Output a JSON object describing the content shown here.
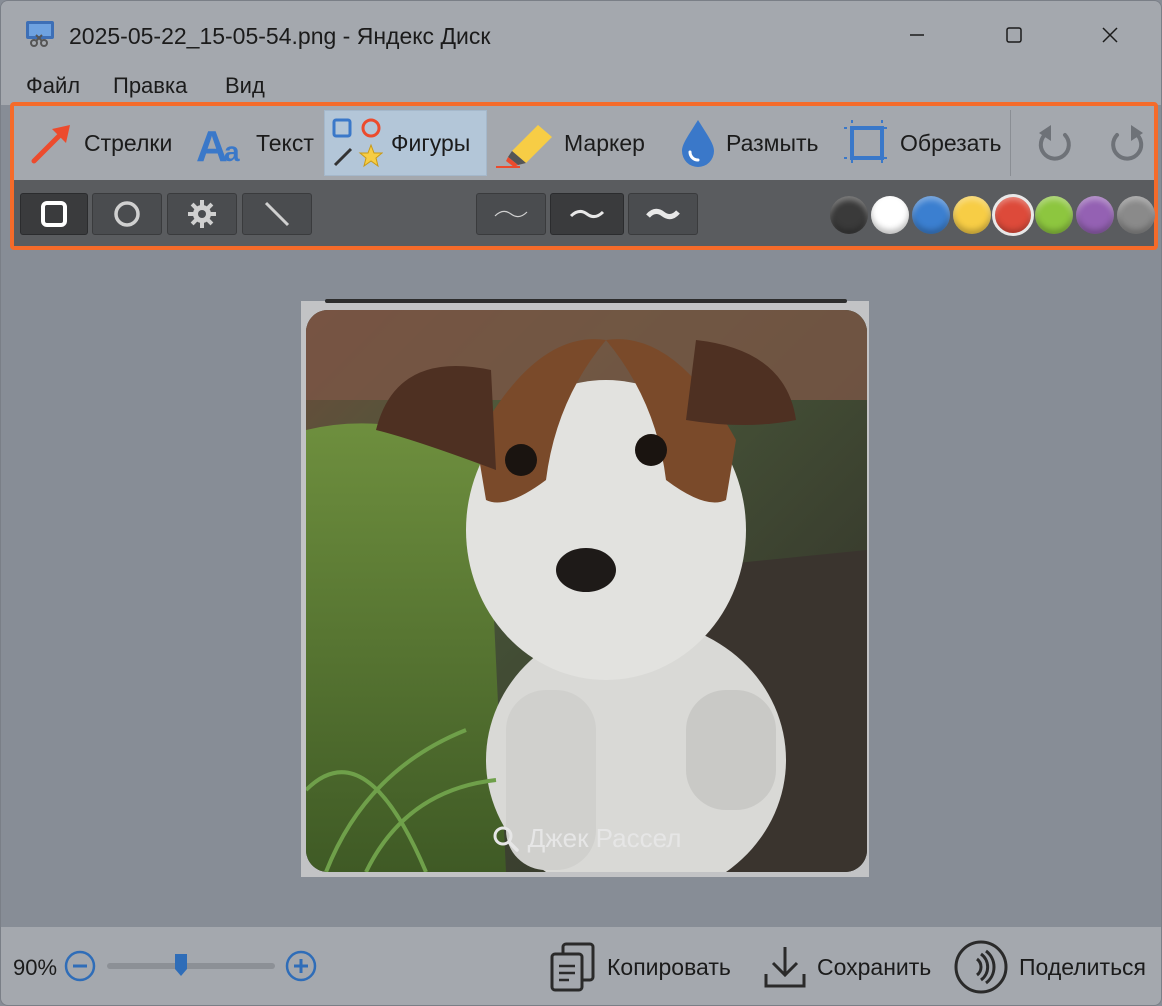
{
  "window": {
    "title": "2025-05-22_15-05-54.png - Яндекс Диск"
  },
  "menu": {
    "items": [
      "Файл",
      "Правка",
      "Вид"
    ]
  },
  "toolbar": {
    "tools": [
      {
        "label": "Стрелки",
        "icon": "arrow-icon",
        "active": false
      },
      {
        "label": "Текст",
        "icon": "text-icon",
        "active": false
      },
      {
        "label": "Фигуры",
        "icon": "shapes-icon",
        "active": true
      },
      {
        "label": "Маркер",
        "icon": "marker-icon",
        "active": false
      },
      {
        "label": "Размыть",
        "icon": "blur-drop-icon",
        "active": false
      },
      {
        "label": "Обрезать",
        "icon": "crop-icon",
        "active": false
      }
    ],
    "undo_icon": "undo-icon",
    "redo_icon": "redo-icon"
  },
  "shape_options": {
    "shapes": [
      "rectangle",
      "ellipse",
      "gear",
      "line"
    ],
    "selected_shape": "rectangle",
    "thickness": [
      "thin",
      "medium",
      "thick"
    ],
    "selected_thickness": "medium",
    "colors": [
      "#3a3a3a",
      "#ffffff",
      "#3b7fd0",
      "#f7cd45",
      "#dd4a3a",
      "#8dc63f",
      "#9461b3",
      "#8a8a8a"
    ],
    "selected_color": "#dd4a3a"
  },
  "image": {
    "caption": "Джек Рассел"
  },
  "bottom": {
    "zoom": "90%",
    "zoom_level": 0.45,
    "copy_label": "Копировать",
    "save_label": "Сохранить",
    "share_label": "Поделиться"
  },
  "colors": {
    "accent_frame": "#f56b2a",
    "active_tool": "#b3c6d8"
  }
}
